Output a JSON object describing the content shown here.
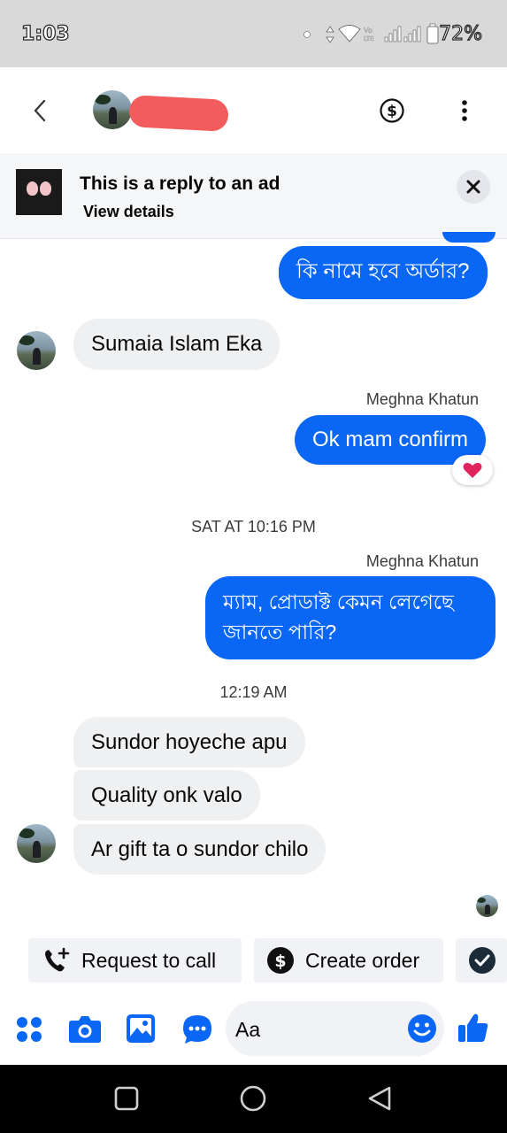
{
  "status_bar": {
    "time": "1:03",
    "battery_text": "72%",
    "icons": [
      "dot-icon",
      "data-arrows-icon",
      "wifi-icon",
      "volte-icon",
      "signal-icon",
      "signal-icon-2",
      "battery-icon"
    ]
  },
  "header": {
    "icons": [
      "back-chevron-icon",
      "contact-avatar",
      "dollar-icon",
      "more-vertical-icon"
    ]
  },
  "ad_banner": {
    "title": "This is a reply to an ad",
    "link": "View details",
    "icons": [
      "ad-thumbnail",
      "close-icon"
    ]
  },
  "messages": [
    {
      "direction": "sent",
      "text": "কি নামে হবে অর্ডার?"
    },
    {
      "direction": "received",
      "text": "Sumaia Islam Eka"
    },
    {
      "direction": "sent",
      "sender": "Meghna Khatun",
      "text": "Ok mam confirm",
      "reaction": "❤️"
    },
    {
      "type": "timestamp",
      "text": "SAT AT 10:16 PM"
    },
    {
      "direction": "sent",
      "sender": "Meghna Khatun",
      "text_line1": "ম্যাম, প্রোডাক্ট কেমন লেগেছে",
      "text_line2": "জানতে পারি?"
    },
    {
      "type": "timestamp",
      "text": "12:19 AM"
    },
    {
      "direction": "received",
      "text": "Sundor hoyeche apu"
    },
    {
      "direction": "received",
      "text": "Quality onk valo"
    },
    {
      "direction": "received",
      "text": "Ar gift ta o sundor chilo"
    }
  ],
  "quick_replies": [
    {
      "label": "Request to call",
      "icon": "phone-plus-icon"
    },
    {
      "label": "Create order",
      "icon": "dollar-circle-icon"
    },
    {
      "label": "",
      "icon": "check-circle-icon"
    }
  ],
  "composer": {
    "placeholder": "Aa",
    "icons": [
      "apps-grid-icon",
      "camera-icon",
      "gallery-icon",
      "chat-bubble-icon",
      "emoji-icon",
      "thumbs-up-icon"
    ]
  },
  "nav_bar": {
    "icons": [
      "recents-square-icon",
      "home-circle-icon",
      "back-triangle-icon"
    ]
  },
  "colors": {
    "accent": "#0a66f5",
    "received_bubble": "#eff0f2",
    "status_bar_bg": "#d9d9d9",
    "redaction": "#f25c5c",
    "heart": "#e0245e"
  }
}
